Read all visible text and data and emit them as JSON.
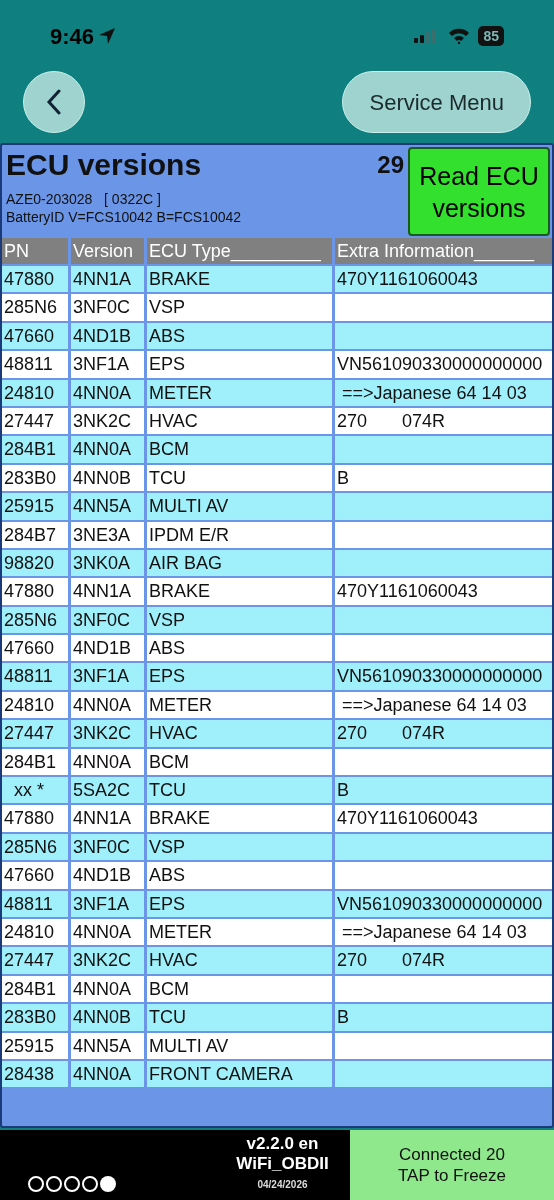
{
  "status_bar": {
    "time": "9:46",
    "battery": "85"
  },
  "nav": {
    "service_button": "Service Menu"
  },
  "panel": {
    "title": "ECU versions",
    "count": "29",
    "read_button": "Read ECU versions",
    "vehicle": "AZE0-203028   [ 0322C ]",
    "battery_id": "BatteryID V=FCS10042 B=FCS10042"
  },
  "table": {
    "columns": [
      "PN",
      "Version",
      "ECU Type_________",
      "Extra Information______"
    ],
    "rows": [
      [
        "47880",
        "4NN1A",
        "BRAKE",
        "470Y1161060043"
      ],
      [
        "285N6",
        "3NF0C",
        "VSP",
        ""
      ],
      [
        "47660",
        "4ND1B",
        "ABS",
        ""
      ],
      [
        "48811",
        "3NF1A",
        "EPS",
        "VN561090330000000000"
      ],
      [
        "24810",
        "4NN0A",
        "METER",
        " ==>Japanese 64 14 03"
      ],
      [
        "27447",
        "3NK2C",
        "HVAC",
        "270       074R"
      ],
      [
        "284B1",
        "4NN0A",
        "BCM",
        ""
      ],
      [
        "283B0",
        "4NN0B",
        "TCU",
        "B"
      ],
      [
        "25915",
        "4NN5A",
        "MULTI AV",
        ""
      ],
      [
        "284B7",
        "3NE3A",
        "IPDM E/R",
        ""
      ],
      [
        "98820",
        "3NK0A",
        "AIR BAG",
        ""
      ],
      [
        "47880",
        "4NN1A",
        "BRAKE",
        "470Y1161060043"
      ],
      [
        "285N6",
        "3NF0C",
        "VSP",
        ""
      ],
      [
        "47660",
        "4ND1B",
        "ABS",
        ""
      ],
      [
        "48811",
        "3NF1A",
        "EPS",
        "VN561090330000000000"
      ],
      [
        "24810",
        "4NN0A",
        "METER",
        " ==>Japanese 64 14 03"
      ],
      [
        "27447",
        "3NK2C",
        "HVAC",
        "270       074R"
      ],
      [
        "284B1",
        "4NN0A",
        "BCM",
        ""
      ],
      [
        "  xx *",
        "5SA2C",
        "TCU",
        "B"
      ],
      [
        "47880",
        "4NN1A",
        "BRAKE",
        "470Y1161060043"
      ],
      [
        "285N6",
        "3NF0C",
        "VSP",
        ""
      ],
      [
        "47660",
        "4ND1B",
        "ABS",
        ""
      ],
      [
        "48811",
        "3NF1A",
        "EPS",
        "VN561090330000000000"
      ],
      [
        "24810",
        "4NN0A",
        "METER",
        " ==>Japanese 64 14 03"
      ],
      [
        "27447",
        "3NK2C",
        "HVAC",
        "270       074R"
      ],
      [
        "284B1",
        "4NN0A",
        "BCM",
        ""
      ],
      [
        "283B0",
        "4NN0B",
        "TCU",
        "B"
      ],
      [
        "25915",
        "4NN5A",
        "MULTI AV",
        ""
      ],
      [
        "28438",
        "4NN0A",
        "FRONT CAMERA",
        ""
      ]
    ]
  },
  "footer": {
    "page_dots": [
      {
        "selected": false
      },
      {
        "selected": false
      },
      {
        "selected": false
      },
      {
        "selected": false
      },
      {
        "selected": true
      }
    ],
    "version": "v2.2.0 en",
    "device": "WiFi_OBDII",
    "date": "04/24/2026",
    "connection": "Connected 20",
    "freeze_hint": "TAP to Freeze"
  }
}
